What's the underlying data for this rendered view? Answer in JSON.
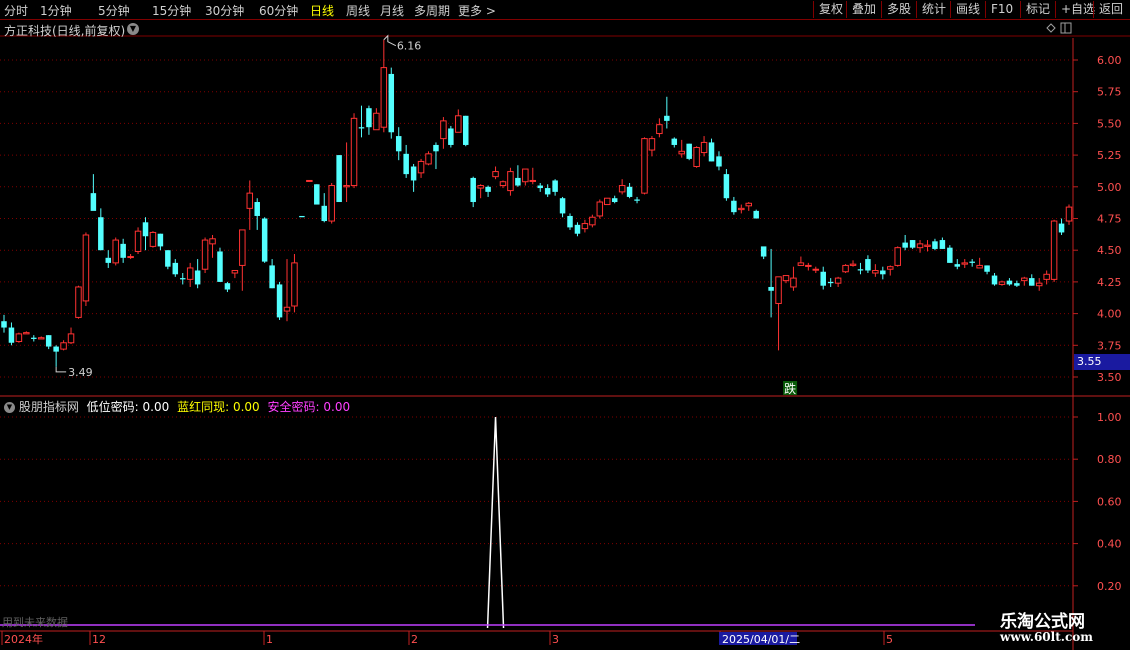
{
  "toolbar": {
    "periods": [
      "分时",
      "1分钟",
      "5分钟",
      "15分钟",
      "30分钟",
      "60分钟",
      "日线",
      "周线",
      "月线",
      "多周期",
      "更多 >"
    ],
    "active_period": "日线",
    "buttons": [
      "复权",
      "叠加",
      "多股",
      "统计",
      "画线",
      "F10",
      "标记",
      "+自选",
      "返回"
    ]
  },
  "main": {
    "stock_title": "方正科技(日线,前复权)",
    "high_label": "6.16",
    "low_label": "3.49",
    "current_price": "3.55",
    "signal_label": "跌",
    "y_axis": [
      "6.00",
      "5.75",
      "5.50",
      "5.25",
      "5.00",
      "4.75",
      "4.50",
      "4.25",
      "4.00",
      "3.75",
      "3.50"
    ]
  },
  "indicator": {
    "name": "股朋指标网",
    "fields": [
      {
        "label": "低位密码:",
        "value": "0.00",
        "color": "#ffffff"
      },
      {
        "label": "蓝红同现:",
        "value": "0.00",
        "color": "#ffff00"
      },
      {
        "label": "安全密码:",
        "value": "0.00",
        "color": "#ff40ff"
      }
    ],
    "y_axis": [
      "1.00",
      "0.80",
      "0.60",
      "0.40",
      "0.20"
    ],
    "future_note": "用到未来数据"
  },
  "x_axis": {
    "labels": [
      "2024年",
      "12",
      "1",
      "2",
      "3",
      "2025/04/01/二",
      "5"
    ]
  },
  "colors": {
    "up": "#ff3232",
    "down": "#54ffff",
    "grid": "#800000",
    "axis": "#c02020"
  },
  "chart_data": {
    "type": "candlestick",
    "price_unit": "CNY",
    "ylim": [
      3.45,
      6.2
    ],
    "candles": [
      [
        3.94,
        3.99,
        3.85,
        3.89
      ],
      [
        3.89,
        3.93,
        3.75,
        3.77
      ],
      [
        3.78,
        3.85,
        3.77,
        3.84
      ],
      [
        3.84,
        3.86,
        3.84,
        3.85
      ],
      [
        3.81,
        3.83,
        3.78,
        3.8
      ],
      [
        3.8,
        3.82,
        3.8,
        3.81
      ],
      [
        3.83,
        3.83,
        3.72,
        3.74
      ],
      [
        3.74,
        3.75,
        3.58,
        3.7
      ],
      [
        3.72,
        3.79,
        3.71,
        3.77
      ],
      [
        3.77,
        3.89,
        3.76,
        3.84
      ],
      [
        3.97,
        4.22,
        3.96,
        4.21
      ],
      [
        4.1,
        4.64,
        4.06,
        4.62
      ],
      [
        4.95,
        5.1,
        4.82,
        4.81
      ],
      [
        4.76,
        4.83,
        4.5,
        4.5
      ],
      [
        4.44,
        4.5,
        4.36,
        4.4
      ],
      [
        4.4,
        4.6,
        4.38,
        4.58
      ],
      [
        4.55,
        4.59,
        4.4,
        4.44
      ],
      [
        4.45,
        4.47,
        4.43,
        4.45
      ],
      [
        4.49,
        4.68,
        4.47,
        4.65
      ],
      [
        4.72,
        4.76,
        4.5,
        4.61
      ],
      [
        4.53,
        4.65,
        4.52,
        4.64
      ],
      [
        4.63,
        4.63,
        4.5,
        4.53
      ],
      [
        4.5,
        4.5,
        4.35,
        4.37
      ],
      [
        4.4,
        4.43,
        4.29,
        4.31
      ],
      [
        4.28,
        4.32,
        4.23,
        4.27
      ],
      [
        4.27,
        4.4,
        4.21,
        4.36
      ],
      [
        4.34,
        4.43,
        4.2,
        4.23
      ],
      [
        4.35,
        4.6,
        4.32,
        4.58
      ],
      [
        4.55,
        4.62,
        4.44,
        4.59
      ],
      [
        4.49,
        4.52,
        4.25,
        4.25
      ],
      [
        4.24,
        4.25,
        4.17,
        4.19
      ],
      [
        4.32,
        4.34,
        4.28,
        4.34
      ],
      [
        4.38,
        4.65,
        4.18,
        4.66
      ],
      [
        4.83,
        5.05,
        4.66,
        4.95
      ],
      [
        4.88,
        4.91,
        4.66,
        4.77
      ],
      [
        4.75,
        4.76,
        4.4,
        4.41
      ],
      [
        4.38,
        4.43,
        4.2,
        4.2
      ],
      [
        4.23,
        4.25,
        3.95,
        3.97
      ],
      [
        4.02,
        4.43,
        3.94,
        4.05
      ],
      [
        4.06,
        4.47,
        4.01,
        4.4
      ],
      [
        4.77,
        4.77,
        4.77,
        4.76
      ],
      [
        5.05,
        5.05,
        5.05,
        5.05
      ],
      [
        5.02,
        5.02,
        4.88,
        4.86
      ],
      [
        4.85,
        4.95,
        4.72,
        4.73
      ],
      [
        4.73,
        5.03,
        4.71,
        5.01
      ],
      [
        5.25,
        5.25,
        4.89,
        4.88
      ],
      [
        5.0,
        5.35,
        4.88,
        5.01
      ],
      [
        5.01,
        5.58,
        4.99,
        5.54
      ],
      [
        5.47,
        5.64,
        5.39,
        5.46
      ],
      [
        5.62,
        5.64,
        5.41,
        5.47
      ],
      [
        5.45,
        5.62,
        5.45,
        5.58
      ],
      [
        5.47,
        6.16,
        5.43,
        5.94
      ],
      [
        5.89,
        5.94,
        5.38,
        5.43
      ],
      [
        5.4,
        5.47,
        5.21,
        5.28
      ],
      [
        5.26,
        5.33,
        5.07,
        5.1
      ],
      [
        5.16,
        5.18,
        4.96,
        5.05
      ],
      [
        5.11,
        5.22,
        5.07,
        5.2
      ],
      [
        5.18,
        5.28,
        5.17,
        5.26
      ],
      [
        5.33,
        5.35,
        5.14,
        5.28
      ],
      [
        5.38,
        5.55,
        5.3,
        5.52
      ],
      [
        5.46,
        5.48,
        5.31,
        5.33
      ],
      [
        5.43,
        5.61,
        5.43,
        5.56
      ],
      [
        5.56,
        5.56,
        5.32,
        5.33
      ],
      [
        5.07,
        5.08,
        4.84,
        4.88
      ],
      [
        4.99,
        5.02,
        4.91,
        5.01
      ],
      [
        5.0,
        5.01,
        4.92,
        4.96
      ],
      [
        5.08,
        5.16,
        5.06,
        5.12
      ],
      [
        5.01,
        5.05,
        4.99,
        5.04
      ],
      [
        4.97,
        5.15,
        4.93,
        5.12
      ],
      [
        5.07,
        5.17,
        5.0,
        5.01
      ],
      [
        5.04,
        5.14,
        5.01,
        5.14
      ],
      [
        5.05,
        5.15,
        5.02,
        5.05
      ],
      [
        5.01,
        5.03,
        4.96,
        4.99
      ],
      [
        4.99,
        5.02,
        4.92,
        4.94
      ],
      [
        5.05,
        5.06,
        4.93,
        4.96
      ],
      [
        4.91,
        4.92,
        4.76,
        4.79
      ],
      [
        4.77,
        4.79,
        4.66,
        4.68
      ],
      [
        4.7,
        4.72,
        4.61,
        4.63
      ],
      [
        4.67,
        4.74,
        4.64,
        4.71
      ],
      [
        4.7,
        4.78,
        4.68,
        4.76
      ],
      [
        4.77,
        4.9,
        4.75,
        4.88
      ],
      [
        4.86,
        4.91,
        4.86,
        4.91
      ],
      [
        4.91,
        4.93,
        4.87,
        4.88
      ],
      [
        4.96,
        5.06,
        4.94,
        5.01
      ],
      [
        5.0,
        5.03,
        4.91,
        4.92
      ],
      [
        4.9,
        4.92,
        4.87,
        4.89
      ],
      [
        4.95,
        5.39,
        4.94,
        5.38
      ],
      [
        5.29,
        5.4,
        5.24,
        5.38
      ],
      [
        5.42,
        5.54,
        5.39,
        5.49
      ],
      [
        5.56,
        5.71,
        5.46,
        5.52
      ],
      [
        5.38,
        5.39,
        5.31,
        5.33
      ],
      [
        5.26,
        5.37,
        5.23,
        5.28
      ],
      [
        5.34,
        5.34,
        5.21,
        5.22
      ],
      [
        5.16,
        5.32,
        5.15,
        5.31
      ],
      [
        5.27,
        5.4,
        5.24,
        5.35
      ],
      [
        5.35,
        5.38,
        5.2,
        5.2
      ],
      [
        5.24,
        5.28,
        5.13,
        5.16
      ],
      [
        5.1,
        5.14,
        4.89,
        4.91
      ],
      [
        4.89,
        4.92,
        4.78,
        4.8
      ],
      [
        4.82,
        4.86,
        4.79,
        4.83
      ],
      [
        4.85,
        4.88,
        4.81,
        4.87
      ],
      [
        4.81,
        4.82,
        4.75,
        4.75
      ],
      [
        4.53,
        4.52,
        4.43,
        4.45
      ],
      [
        4.21,
        4.51,
        3.97,
        4.18
      ],
      [
        4.08,
        4.28,
        3.71,
        4.29
      ],
      [
        4.26,
        4.3,
        4.24,
        4.3
      ],
      [
        4.21,
        4.37,
        4.18,
        4.28
      ],
      [
        4.38,
        4.45,
        4.38,
        4.4
      ],
      [
        4.38,
        4.4,
        4.34,
        4.38
      ],
      [
        4.35,
        4.37,
        4.32,
        4.35
      ],
      [
        4.33,
        4.37,
        4.19,
        4.22
      ],
      [
        4.25,
        4.28,
        4.21,
        4.24
      ],
      [
        4.24,
        4.29,
        4.21,
        4.28
      ],
      [
        4.33,
        4.39,
        4.32,
        4.38
      ],
      [
        4.38,
        4.42,
        4.37,
        4.39
      ],
      [
        4.35,
        4.4,
        4.31,
        4.34
      ],
      [
        4.43,
        4.46,
        4.32,
        4.34
      ],
      [
        4.32,
        4.39,
        4.29,
        4.34
      ],
      [
        4.34,
        4.37,
        4.27,
        4.31
      ],
      [
        4.35,
        4.38,
        4.3,
        4.37
      ],
      [
        4.38,
        4.53,
        4.37,
        4.52
      ],
      [
        4.56,
        4.62,
        4.5,
        4.52
      ],
      [
        4.58,
        4.58,
        4.51,
        4.52
      ],
      [
        4.52,
        4.58,
        4.48,
        4.55
      ],
      [
        4.53,
        4.58,
        4.49,
        4.54
      ],
      [
        4.57,
        4.59,
        4.5,
        4.51
      ],
      [
        4.58,
        4.6,
        4.51,
        4.51
      ],
      [
        4.52,
        4.54,
        4.4,
        4.4
      ],
      [
        4.39,
        4.43,
        4.35,
        4.37
      ],
      [
        4.39,
        4.43,
        4.36,
        4.4
      ],
      [
        4.41,
        4.43,
        4.37,
        4.4
      ],
      [
        4.36,
        4.44,
        4.36,
        4.38
      ],
      [
        4.38,
        4.38,
        4.31,
        4.33
      ],
      [
        4.3,
        4.32,
        4.22,
        4.23
      ],
      [
        4.23,
        4.26,
        4.22,
        4.25
      ],
      [
        4.26,
        4.28,
        4.22,
        4.23
      ],
      [
        4.24,
        4.26,
        4.21,
        4.22
      ],
      [
        4.26,
        4.29,
        4.22,
        4.28
      ],
      [
        4.28,
        4.31,
        4.22,
        4.22
      ],
      [
        4.22,
        4.28,
        4.18,
        4.24
      ],
      [
        4.27,
        4.34,
        4.23,
        4.31
      ],
      [
        4.27,
        4.74,
        4.25,
        4.73
      ],
      [
        4.71,
        4.75,
        4.62,
        4.64
      ],
      [
        4.73,
        4.86,
        4.7,
        4.84
      ]
    ],
    "indicator_series": {
      "name": "低位密码",
      "spike_index": 66,
      "spike_value": 1.0,
      "ylim": [
        0,
        1.05
      ]
    }
  }
}
